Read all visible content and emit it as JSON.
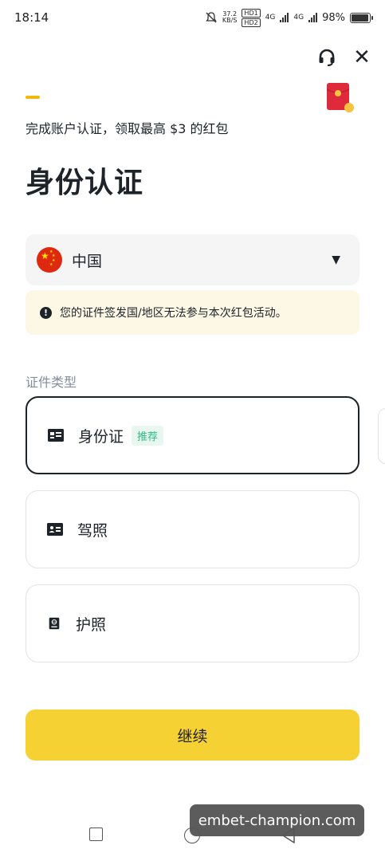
{
  "status_bar": {
    "time": "18:14",
    "net_speed": "37.2",
    "net_unit": "KB/S",
    "hd1": "HD1",
    "hd2": "HD2",
    "net1": "4G",
    "net2": "4G",
    "battery": "98%"
  },
  "header": {
    "support_icon": "headset-icon",
    "close_label": "✕",
    "progress_fraction": 0.06,
    "reward_icon": "red-packet-icon"
  },
  "promo": "完成账户认证，领取最高 $3 的红包",
  "title": "身份认证",
  "country": {
    "name": "中国",
    "flag_icon": "china-flag-icon"
  },
  "warning": {
    "icon_glyph": "!",
    "text": "您的证件签发国/地区无法参与本次红包活动。"
  },
  "doc_type_label": "证件类型",
  "doc_options": [
    {
      "label": "身份证",
      "badge": "推荐",
      "selected": true
    },
    {
      "label": "驾照",
      "selected": false
    },
    {
      "label": "护照",
      "selected": false
    }
  ],
  "continue_label": "继续",
  "watermark": "embet-champion.com",
  "colors": {
    "accent": "#f0b90b",
    "button": "#f5d134",
    "badge_text": "#2ebd85",
    "warning_bg": "#fdf7e6"
  }
}
